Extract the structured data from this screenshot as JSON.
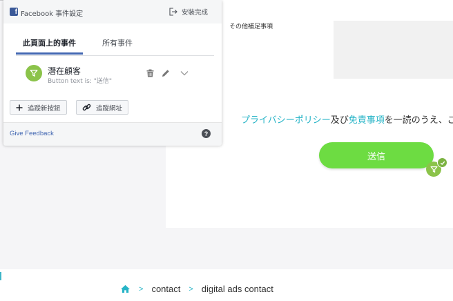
{
  "panel": {
    "title": "Facebook 事件設定",
    "finish_label": "安裝完成",
    "tabs": [
      {
        "label": "此頁面上的事件",
        "active": true
      },
      {
        "label": "所有事件",
        "active": false
      }
    ],
    "event": {
      "title": "潛在顧客",
      "subtitle": "Button text is: \"送信\""
    },
    "add_button_label": "追蹤新按鈕",
    "add_url_label": "追蹤網址",
    "feedback_label": "Give Feedback",
    "help_label": "?"
  },
  "page": {
    "form_label": "その他補足事項",
    "privacy": {
      "link1": "プライバシーポリシー",
      "text1": "及び",
      "link2": "免責事項",
      "text2": "を一読のうえ、ご新"
    },
    "send_button_label": "送信",
    "breadcrumb": {
      "items": [
        "contact",
        "digital ads contact"
      ],
      "separator": ">"
    }
  },
  "colors": {
    "accent_green": "#6ddc42",
    "link_teal": "#27b4c7",
    "facebook_blue": "#4267b2",
    "event_icon_green": "#8bc34a"
  },
  "icons": [
    "facebook-icon",
    "exit-icon",
    "funnel-icon",
    "trash-icon",
    "pencil-icon",
    "chevron-down-icon",
    "plus-icon",
    "link-icon",
    "help-icon",
    "check-icon",
    "home-icon"
  ]
}
